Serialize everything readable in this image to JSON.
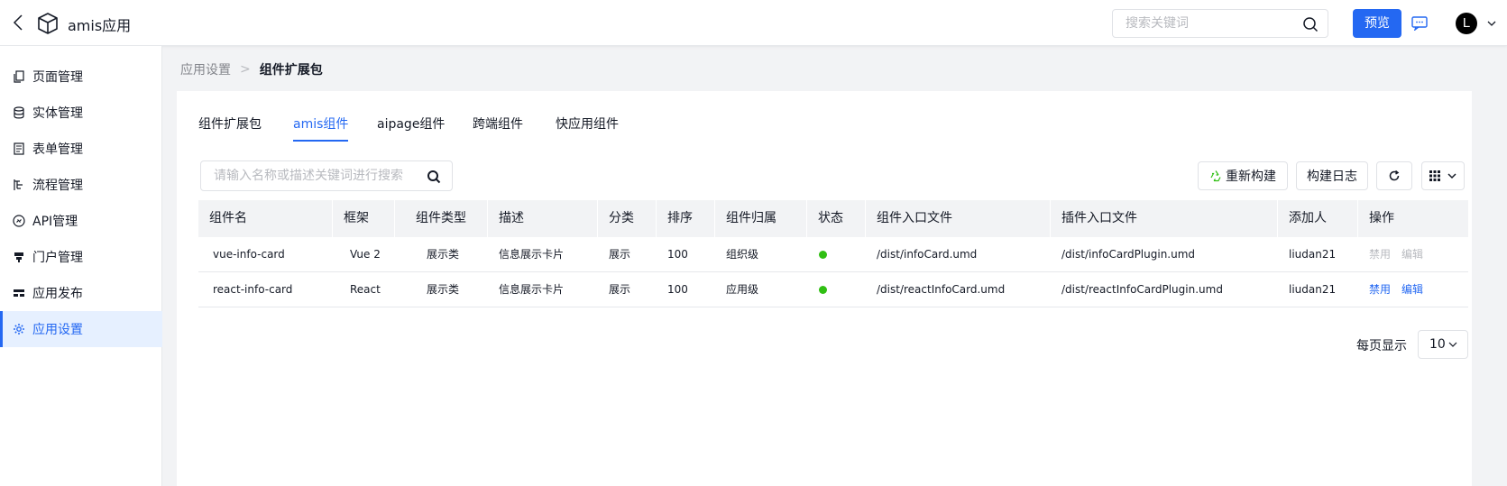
{
  "header": {
    "app_title": "amis应用",
    "search_placeholder": "搜索关键词",
    "preview_label": "预览",
    "avatar_letter": "L"
  },
  "sidebar": {
    "items": [
      {
        "label": "页面管理",
        "icon": "page-copy-icon"
      },
      {
        "label": "实体管理",
        "icon": "database-icon"
      },
      {
        "label": "表单管理",
        "icon": "form-icon"
      },
      {
        "label": "流程管理",
        "icon": "flow-icon"
      },
      {
        "label": "API管理",
        "icon": "api-icon"
      },
      {
        "label": "门户管理",
        "icon": "portal-icon"
      },
      {
        "label": "应用发布",
        "icon": "publish-icon"
      },
      {
        "label": "应用设置",
        "icon": "gear-icon",
        "active": true
      }
    ]
  },
  "breadcrumb": {
    "parent": "应用设置",
    "separator": ">",
    "current": "组件扩展包"
  },
  "tabs": [
    {
      "label": "组件扩展包"
    },
    {
      "label": "amis组件",
      "active": true
    },
    {
      "label": "aipage组件"
    },
    {
      "label": "跨端组件"
    },
    {
      "label": "快应用组件"
    }
  ],
  "toolbar": {
    "filter_placeholder": "请输入名称或描述关键词进行搜索",
    "rebuild_label": "重新构建",
    "build_log_label": "构建日志"
  },
  "table": {
    "columns": [
      "组件名",
      "框架",
      "组件类型",
      "描述",
      "分类",
      "排序",
      "组件归属",
      "状态",
      "组件入口文件",
      "插件入口文件",
      "添加人",
      "操作"
    ],
    "rows": [
      {
        "name": "vue-info-card",
        "framework": "Vue 2",
        "type": "展示类",
        "desc": "信息展示卡片",
        "category": "展示",
        "order": "100",
        "owner": "组织级",
        "status": "active",
        "entry": "/dist/infoCard.umd",
        "plugin_entry": "/dist/infoCardPlugin.umd",
        "creator": "liudan21",
        "disable_label": "禁用",
        "edit_label": "编辑",
        "actions_enabled": false
      },
      {
        "name": "react-info-card",
        "framework": "React",
        "type": "展示类",
        "desc": "信息展示卡片",
        "category": "展示",
        "order": "100",
        "owner": "应用级",
        "status": "active",
        "entry": "/dist/reactInfoCard.umd",
        "plugin_entry": "/dist/reactInfoCardPlugin.umd",
        "creator": "liudan21",
        "disable_label": "禁用",
        "edit_label": "编辑",
        "actions_enabled": true
      }
    ]
  },
  "pagination": {
    "per_page_label": "每页显示",
    "per_page_value": "10"
  },
  "colors": {
    "accent": "#2468f2",
    "status_active": "#30bf13",
    "disabled_text": "#b8babf"
  }
}
